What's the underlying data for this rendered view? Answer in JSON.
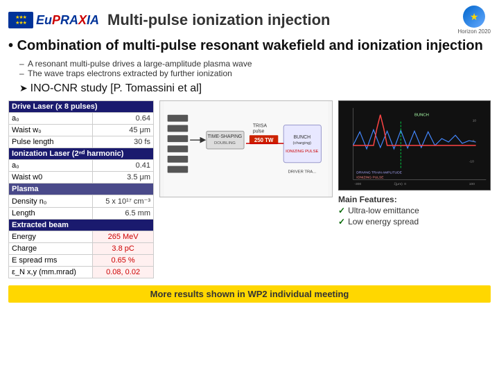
{
  "header": {
    "logo_text": "EuPRAXIA",
    "title": "Multi-pulse ionization injection",
    "horizon_label": "Horizon 2020"
  },
  "content": {
    "bullet_heading": "Combination of multi-pulse resonant wakefield and ionization injection",
    "sub_items": [
      "A resonant multi-pulse drives a large-amplitude plasma wave",
      "The wave traps electrons extracted by further ionization"
    ],
    "arrow_heading": "INO-CNR study [P. Tomassini et al]"
  },
  "table": {
    "sections": [
      {
        "header": "Drive Laser (x 8 pulses)",
        "rows": [
          {
            "param": "a₀",
            "value": "0.64"
          },
          {
            "param": "Waist w₀",
            "value": "45 μm"
          },
          {
            "param": "Pulse length",
            "value": "30 fs"
          }
        ]
      },
      {
        "header": "Ionization Laser (2ⁿᵈ harmonic)",
        "rows": [
          {
            "param": "a₀",
            "value": "0.41"
          },
          {
            "param": "Waist w0",
            "value": "3.5 μm"
          }
        ]
      },
      {
        "header": "Plasma",
        "rows": [
          {
            "param": "Density n₀",
            "value": "5 x 10¹⁷ cm⁻³"
          },
          {
            "param": "Length",
            "value": "6.5 mm"
          }
        ]
      },
      {
        "header": "Extracted beam",
        "rows": [
          {
            "param": "Energy",
            "value": "265 MeV",
            "highlight": true
          },
          {
            "param": "Charge",
            "value": "3.8 pC",
            "highlight": true
          },
          {
            "param": "E spread rms",
            "value": "0.65 %",
            "highlight": true
          },
          {
            "param": "ε_N x,y (mm.mrad)",
            "value": "0.08, 0.02",
            "highlight": true
          }
        ]
      }
    ]
  },
  "features": {
    "title": "Main Features:",
    "items": [
      "Ultra-low emittance",
      "Low energy spread"
    ]
  },
  "bottom_banner": "More results shown in WP2 individual meeting",
  "diagram_label": "250 TW",
  "plot_labels": {
    "driving": "DRIVING TRAIN AMPLITUDE",
    "ionizing": "IONIZING PULSE"
  }
}
